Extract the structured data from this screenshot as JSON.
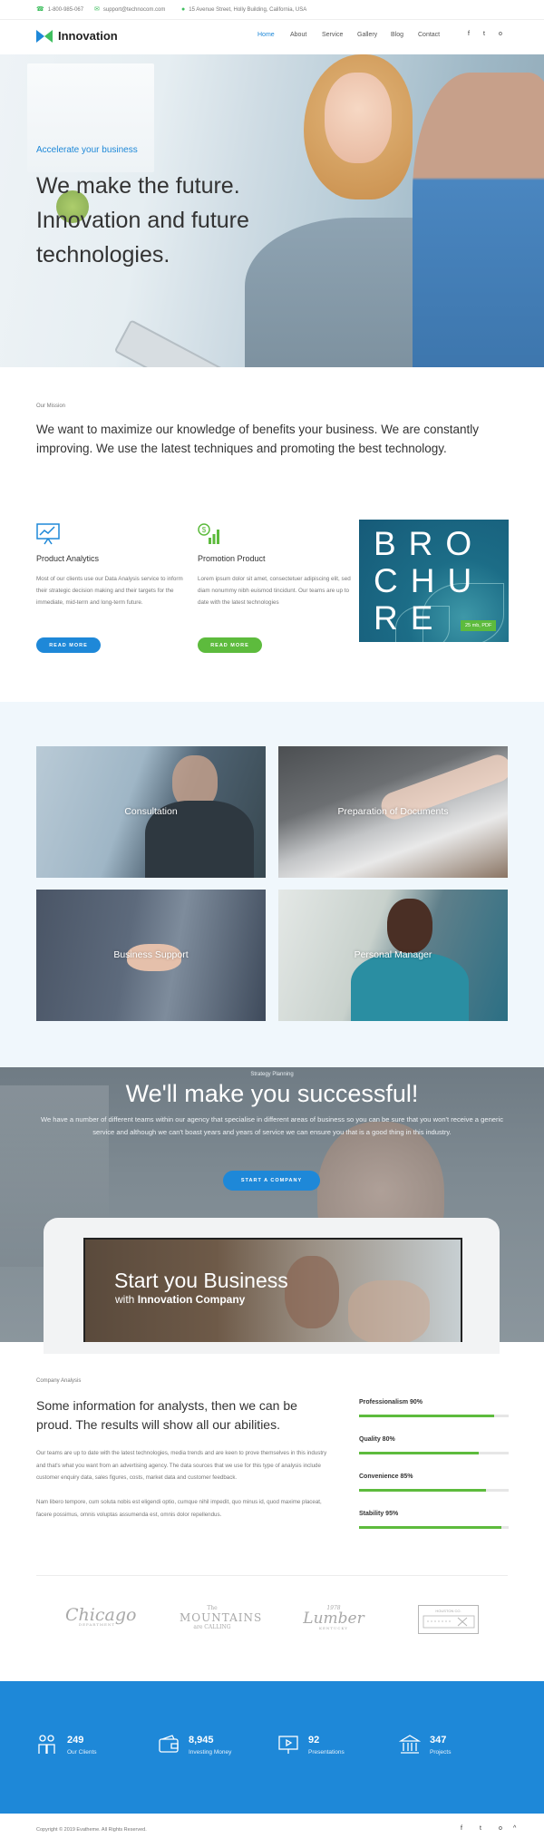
{
  "topbar": {
    "phone": "1-800-985-067",
    "email": "support@technocom.com",
    "address": "15 Avenue Street, Holly Building, California, USA"
  },
  "header": {
    "logo_text": "Innovation",
    "nav": [
      "Home",
      "About",
      "Service",
      "Gallery",
      "Blog",
      "Contact"
    ],
    "social": [
      "f",
      "t",
      "o"
    ]
  },
  "hero": {
    "subtitle": "Accelerate your business",
    "title": "We make the future. Innovation and future technologies."
  },
  "mission": {
    "label": "Our Mission",
    "text": "We want to maximize our knowledge of benefits your business. We are constantly improving. We use the latest techniques and promoting the best technology."
  },
  "services": [
    {
      "title": "Product Analytics",
      "text": "Most of our clients use our Data Analysis service to inform their strategic decision making and their targets for the immediate, mid-term and long-term future.",
      "button": "READ MORE"
    },
    {
      "title": "Promotion Product",
      "text": "Lorem ipsum dolor sit amet, consectetuer adipiscing elit, sed diam nonummy nibh euismod tincidunt. Our teams are up to date with the latest technologies",
      "button": "READ MORE"
    }
  ],
  "brochure": {
    "line1": "BRO",
    "line2": "CHU",
    "line3": "RE",
    "tag": "25 mb, PDF"
  },
  "gallery": [
    {
      "caption": "Consultation"
    },
    {
      "caption": "Preparation of Documents"
    },
    {
      "caption": "Business Support"
    },
    {
      "caption": "Personal Manager"
    }
  ],
  "strategy": {
    "label": "Strategy Planning",
    "title": "We'll make you successful!",
    "text": "We have a number of different teams within our agency that specialise in different areas of business so you can be sure that you won't receive a generic service and although we can't boast years and years of service we can ensure you that is a good thing in this industry.",
    "button": "START A COMPANY",
    "screen_title": "Start you Business",
    "screen_sub_prefix": "with",
    "screen_sub_bold": "Innovation Company"
  },
  "analysis": {
    "label": "Company Analysis",
    "title": "Some information for analysts, then we can be proud. The results will show all our abilities.",
    "p1": "Our teams are up to date with the latest technologies, media trends and are keen to prove themselves in this industry and that's what you want from an advertising agency. The data sources that we use for this type of analysis include customer enquiry data, sales figures, costs, market data and customer feedback.",
    "p2": "Nam libero tempore, cum soluta nobis est eligendi optio, cumque nihil impedit, quo minus id, quod maxime placeat, facere possimus, omnis voluptas assumenda est, omnis dolor repellendus.",
    "skills": [
      {
        "label": "Professionalism 90%",
        "value": 0.9
      },
      {
        "label": "Quality 80%",
        "value": 0.8
      },
      {
        "label": "Convenience 85%",
        "value": 0.85
      },
      {
        "label": "Stability 95%",
        "value": 0.95
      }
    ]
  },
  "logos": {
    "chicago": "Chicago",
    "chicago_sub": "DEPARTMENT",
    "mountains_top": "The",
    "mountains_big": "MOUNTAINS",
    "mountains_bottom": "are CALLING",
    "lumber_year": "1978",
    "lumber_big": "Lumber",
    "lumber_sub": "KENTUCKY",
    "houston": "HOUSTON CO."
  },
  "stats": [
    {
      "number": "249",
      "label": "Our Clients",
      "icon": "people-icon"
    },
    {
      "number": "8,945",
      "label": "Investing Money",
      "icon": "wallet-icon"
    },
    {
      "number": "92",
      "label": "Presentations",
      "icon": "presentation-icon"
    },
    {
      "number": "347",
      "label": "Projects",
      "icon": "bank-icon"
    }
  ],
  "footer": {
    "copyright": "Copyright © 2019 Evatheme. All Rights Reserved.",
    "social": [
      "f",
      "t",
      "o"
    ],
    "top": "^"
  },
  "colors": {
    "accent_blue": "#1e88d8",
    "accent_green": "#5dbb3d"
  }
}
